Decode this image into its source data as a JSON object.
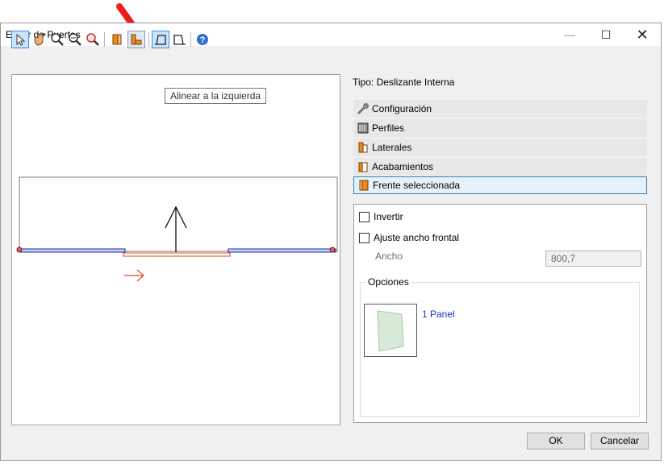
{
  "window": {
    "title": "Editor de Puertas",
    "minimize_glyph": "—",
    "maximize_glyph": "☐",
    "close_glyph": "✕"
  },
  "toolbar": {
    "buttons": [
      {
        "name": "select-pointer-icon"
      },
      {
        "name": "pan-hand-icon"
      },
      {
        "name": "zoom-in-icon"
      },
      {
        "name": "zoom-out-icon"
      },
      {
        "name": "zoom-fit-icon"
      },
      {
        "name": "side-panel-icon"
      },
      {
        "name": "side-panel-pressed-icon"
      },
      {
        "name": "align-left-icon"
      },
      {
        "name": "align-right-icon"
      },
      {
        "name": "help-icon"
      }
    ],
    "tooltip": "Alinear a la izquierda"
  },
  "right": {
    "tipo": "Tipo: Deslizante Interna",
    "sections": [
      {
        "label": "Configuración",
        "icon": "wrench-icon"
      },
      {
        "label": "Perfiles",
        "icon": "profiles-icon"
      },
      {
        "label": "Laterales",
        "icon": "side-piece-icon"
      },
      {
        "label": "Acabamientos",
        "icon": "finish-icon"
      },
      {
        "label": "Frente seleccionada",
        "icon": "front-icon"
      }
    ],
    "invertir": "Invertir",
    "ajuste": "Ajuste ancho frontal",
    "ancho_label": "Ancho",
    "ancho_value": "800,7",
    "opciones": "Opciones",
    "option_label": "1 Panel"
  },
  "buttons": {
    "ok": "OK",
    "cancel": "Cancelar"
  },
  "colors": {
    "accent": "#3a8ee6",
    "door_blue": "#1c2aa8",
    "door_red": "#e0481f",
    "link": "#1a32c8"
  }
}
